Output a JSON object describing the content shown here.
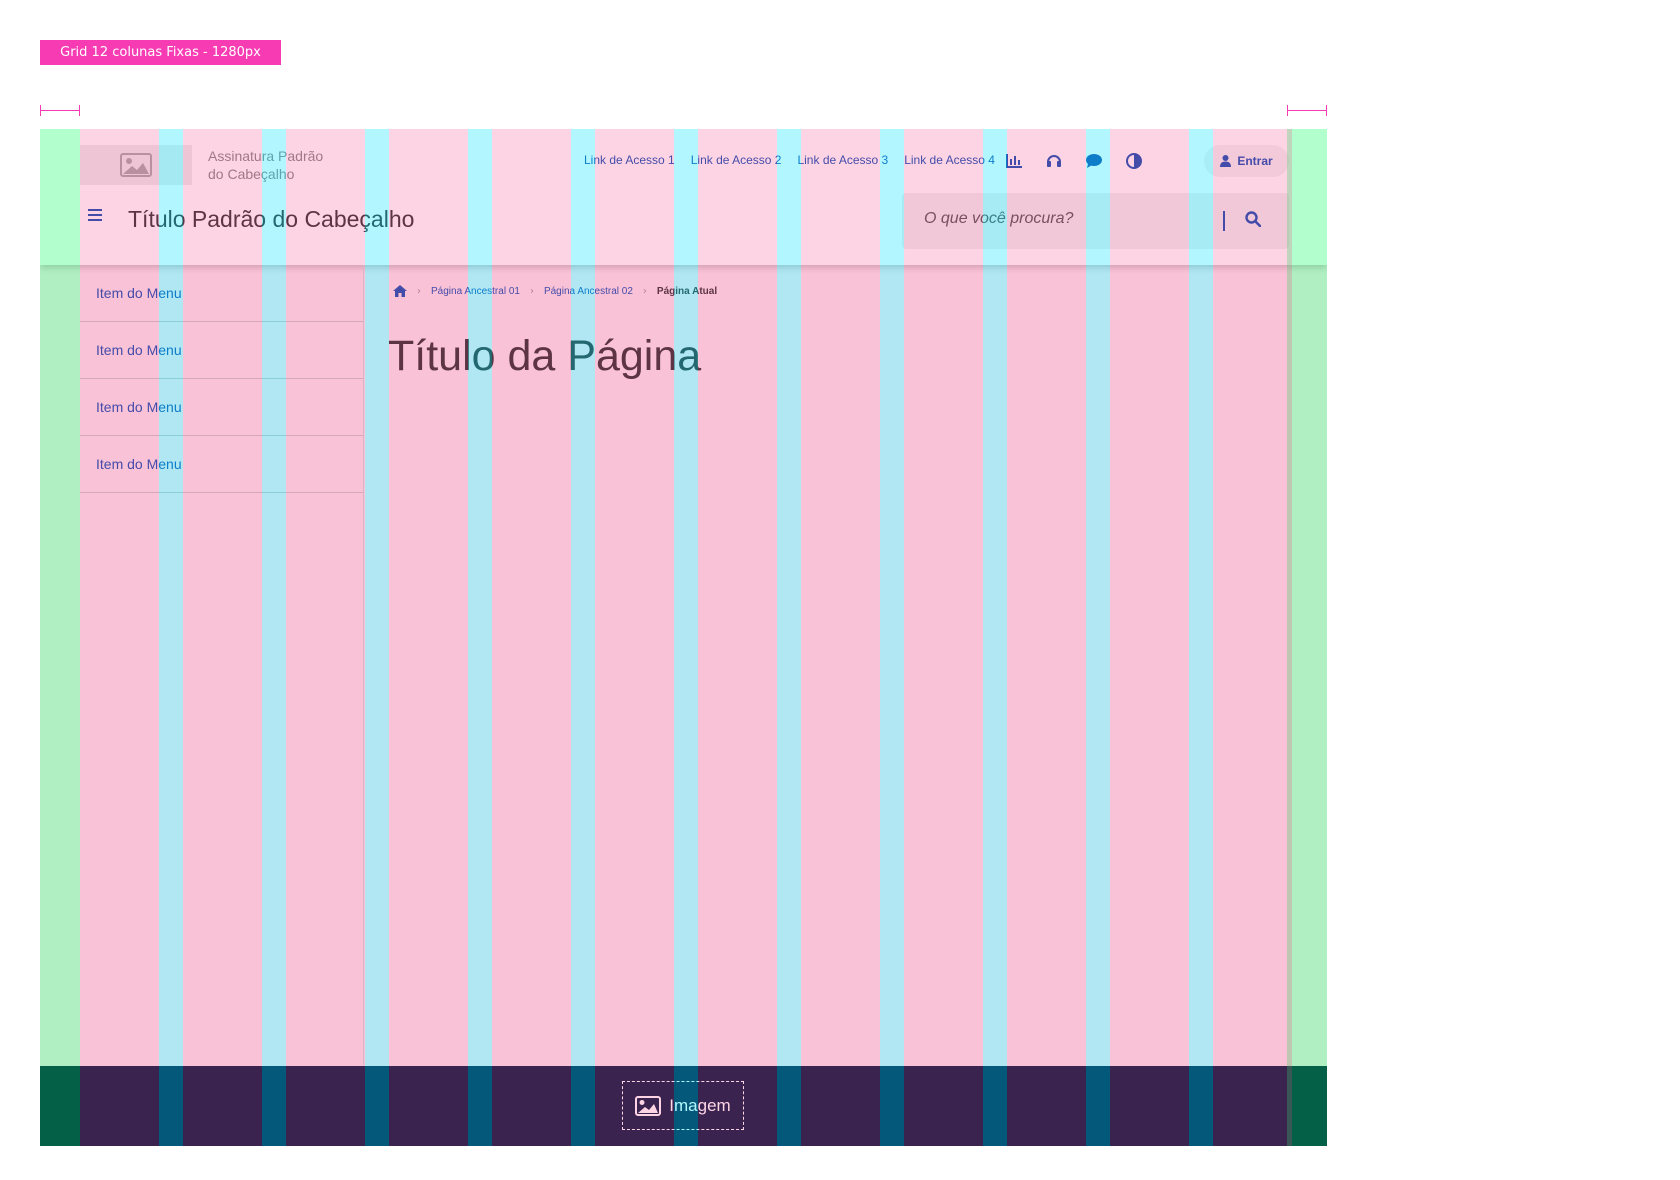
{
  "grid_label": "Grid 12 colunas Fixas - 1280px",
  "header": {
    "logo_icon": "image-icon",
    "signature_line1": "Assinatura Padrão",
    "signature_line2": "do Cabeçalho",
    "quick_links": [
      "Link de Acesso 1",
      "Link de Acesso 2",
      "Link de Acesso 3",
      "Link de Acesso 4"
    ],
    "functions": [
      "chart-bar-icon",
      "headset-icon",
      "comment-icon",
      "contrast-icon"
    ],
    "login_label": "Entrar",
    "title": "Título Padrão do Cabeçalho",
    "search_placeholder": "O que você procura?"
  },
  "menu": {
    "items": [
      "Item do Menu",
      "Item do Menu",
      "Item do Menu",
      "Item do Menu"
    ]
  },
  "breadcrumb": {
    "home_icon": "home-icon",
    "items": [
      "Página Ancestral 01",
      "Página Ancestral 02",
      "Página Atual"
    ]
  },
  "page": {
    "title": "Título da Página"
  },
  "footer": {
    "image_label": "Imagem"
  },
  "colors": {
    "grid_label_bg": "#f73bb3",
    "primary": "#1351b4",
    "footer_bg": "#071d41",
    "overlay_margin": "#00ff5a",
    "overlay_column": "#f73b82",
    "overlay_gutter": "#00e6ff"
  }
}
